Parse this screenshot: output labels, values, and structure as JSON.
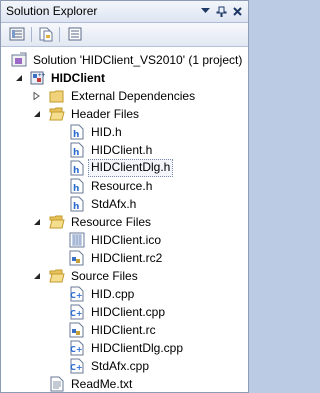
{
  "window": {
    "title": "Solution Explorer",
    "buttons": [
      "dropdown-icon",
      "pin-icon",
      "close-icon"
    ]
  },
  "toolbar": {
    "buttons": [
      "properties-icon",
      "show-all-files-icon",
      "view-class-diagram-icon"
    ]
  },
  "tree": {
    "solution": {
      "label": "Solution 'HIDClient_VS2010' (1 project)",
      "icon": "solution-icon"
    },
    "project": {
      "label": "HIDClient",
      "icon": "project-icon",
      "expanded": true
    },
    "folders": [
      {
        "label": "External Dependencies",
        "icon": "folder-icon",
        "expanded": false,
        "items": []
      },
      {
        "label": "Header Files",
        "icon": "folder-open-icon",
        "expanded": true,
        "items": [
          {
            "label": "HID.h",
            "icon": "header-file-icon"
          },
          {
            "label": "HIDClient.h",
            "icon": "header-file-icon"
          },
          {
            "label": "HIDClientDlg.h",
            "icon": "header-file-icon",
            "selected": true
          },
          {
            "label": "Resource.h",
            "icon": "header-file-icon"
          },
          {
            "label": "StdAfx.h",
            "icon": "header-file-icon"
          }
        ]
      },
      {
        "label": "Resource Files",
        "icon": "folder-open-icon",
        "expanded": true,
        "items": [
          {
            "label": "HIDClient.ico",
            "icon": "icon-file-icon"
          },
          {
            "label": "HIDClient.rc2",
            "icon": "rc2-file-icon"
          }
        ]
      },
      {
        "label": "Source Files",
        "icon": "folder-open-icon",
        "expanded": true,
        "items": [
          {
            "label": "HID.cpp",
            "icon": "cpp-file-icon"
          },
          {
            "label": "HIDClient.cpp",
            "icon": "cpp-file-icon"
          },
          {
            "label": "HIDClient.rc",
            "icon": "rc-file-icon"
          },
          {
            "label": "HIDClientDlg.cpp",
            "icon": "cpp-file-icon"
          },
          {
            "label": "StdAfx.cpp",
            "icon": "cpp-file-icon"
          }
        ]
      }
    ],
    "files": [
      {
        "label": "ReadMe.txt",
        "icon": "text-file-icon"
      }
    ]
  },
  "colors": {
    "titlebar": "#dde5f2",
    "border": "#8e9bb5",
    "folder": "#e8c25a",
    "cpp_accent": "#2a6bd0"
  }
}
